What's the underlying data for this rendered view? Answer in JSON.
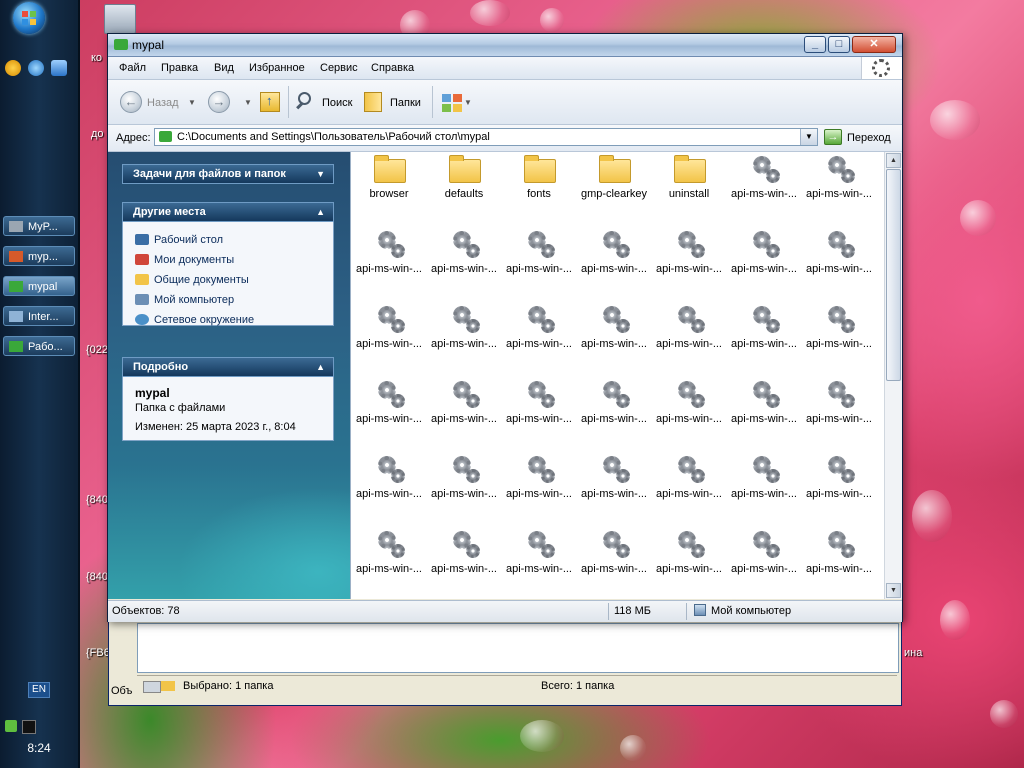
{
  "window": {
    "title": "mypal",
    "controls": {
      "minimize": "_",
      "maximize": "□",
      "close": "✕"
    }
  },
  "menubar": [
    "Файл",
    "Правка",
    "Вид",
    "Избранное",
    "Сервис",
    "Справка"
  ],
  "toolbar": {
    "back_label": "Назад",
    "search_label": "Поиск",
    "folders_label": "Папки"
  },
  "addressbar": {
    "label": "Адрес:",
    "path": "C:\\Documents and Settings\\Пользователь\\Рабочий стол\\mypal",
    "go_label": "Переход"
  },
  "taskpane": {
    "file_tasks_title": "Задачи для файлов и папок",
    "other_places_title": "Другие места",
    "other_places": [
      {
        "label": "Рабочий стол",
        "icon": "desktop-icon",
        "color": "#3a6ea5"
      },
      {
        "label": "Мои документы",
        "icon": "my-documents-icon",
        "color": "#d0463a"
      },
      {
        "label": "Общие документы",
        "icon": "shared-documents-icon",
        "color": "#f2c448"
      },
      {
        "label": "Мой компьютер",
        "icon": "my-computer-icon",
        "color": "#6c8fb5"
      },
      {
        "label": "Сетевое окружение",
        "icon": "network-icon",
        "color": "#4a90c8"
      }
    ],
    "details_title": "Подробно",
    "details": {
      "name": "mypal",
      "type": "Папка с файлами",
      "modified": "Изменен: 25 марта 2023 г., 8:04"
    }
  },
  "files": [
    {
      "name": "browser",
      "kind": "folder"
    },
    {
      "name": "defaults",
      "kind": "folder"
    },
    {
      "name": "fonts",
      "kind": "folder"
    },
    {
      "name": "gmp-clearkey",
      "kind": "folder"
    },
    {
      "name": "uninstall",
      "kind": "folder"
    },
    {
      "name": "api-ms-win-...",
      "kind": "dll"
    },
    {
      "name": "api-ms-win-...",
      "kind": "dll"
    },
    {
      "name": "api-ms-win-...",
      "kind": "dll"
    },
    {
      "name": "api-ms-win-...",
      "kind": "dll"
    },
    {
      "name": "api-ms-win-...",
      "kind": "dll"
    },
    {
      "name": "api-ms-win-...",
      "kind": "dll"
    },
    {
      "name": "api-ms-win-...",
      "kind": "dll"
    },
    {
      "name": "api-ms-win-...",
      "kind": "dll"
    },
    {
      "name": "api-ms-win-...",
      "kind": "dll"
    },
    {
      "name": "api-ms-win-...",
      "kind": "dll"
    },
    {
      "name": "api-ms-win-...",
      "kind": "dll"
    },
    {
      "name": "api-ms-win-...",
      "kind": "dll"
    },
    {
      "name": "api-ms-win-...",
      "kind": "dll"
    },
    {
      "name": "api-ms-win-...",
      "kind": "dll"
    },
    {
      "name": "api-ms-win-...",
      "kind": "dll"
    },
    {
      "name": "api-ms-win-...",
      "kind": "dll"
    },
    {
      "name": "api-ms-win-...",
      "kind": "dll"
    },
    {
      "name": "api-ms-win-...",
      "kind": "dll"
    },
    {
      "name": "api-ms-win-...",
      "kind": "dll"
    },
    {
      "name": "api-ms-win-...",
      "kind": "dll"
    },
    {
      "name": "api-ms-win-...",
      "kind": "dll"
    },
    {
      "name": "api-ms-win-...",
      "kind": "dll"
    },
    {
      "name": "api-ms-win-...",
      "kind": "dll"
    },
    {
      "name": "api-ms-win-...",
      "kind": "dll"
    },
    {
      "name": "api-ms-win-...",
      "kind": "dll"
    },
    {
      "name": "api-ms-win-...",
      "kind": "dll"
    },
    {
      "name": "api-ms-win-...",
      "kind": "dll"
    },
    {
      "name": "api-ms-win-...",
      "kind": "dll"
    },
    {
      "name": "api-ms-win-...",
      "kind": "dll"
    },
    {
      "name": "api-ms-win-...",
      "kind": "dll"
    },
    {
      "name": "api-ms-win-...",
      "kind": "dll"
    },
    {
      "name": "api-ms-win-...",
      "kind": "dll"
    },
    {
      "name": "api-ms-win-...",
      "kind": "dll"
    },
    {
      "name": "api-ms-win-...",
      "kind": "dll"
    },
    {
      "name": "api-ms-win-...",
      "kind": "dll"
    },
    {
      "name": "api-ms-win-...",
      "kind": "dll"
    },
    {
      "name": "api-ms-win-...",
      "kind": "dll"
    }
  ],
  "statusbar": {
    "objects": "Объектов: 78",
    "size": "118 МБ",
    "location": "Мой компьютер"
  },
  "background_window": {
    "selected": "Выбрано: 1 папка",
    "total": "Всего: 1 папка",
    "cut_label": "Объ"
  },
  "taskbar": {
    "buttons": [
      {
        "label": "MyP...",
        "icon": "drive-icon",
        "color": "#9aa6b2"
      },
      {
        "label": "myp...",
        "icon": "archive-icon",
        "color": "#d65a2a"
      },
      {
        "label": "mypal",
        "icon": "folder-icon",
        "color": "#3aa83a",
        "active": true
      },
      {
        "label": "Inter...",
        "icon": "network-icon",
        "color": "#8fb3d6"
      },
      {
        "label": "Рабо...",
        "icon": "folder-icon",
        "color": "#3aa83a"
      }
    ],
    "language": "EN",
    "clock": "8:24"
  },
  "desktop_fragments": [
    "ко",
    "до",
    "{022",
    "{840",
    "{840",
    "{FB6",
    "ина"
  ]
}
